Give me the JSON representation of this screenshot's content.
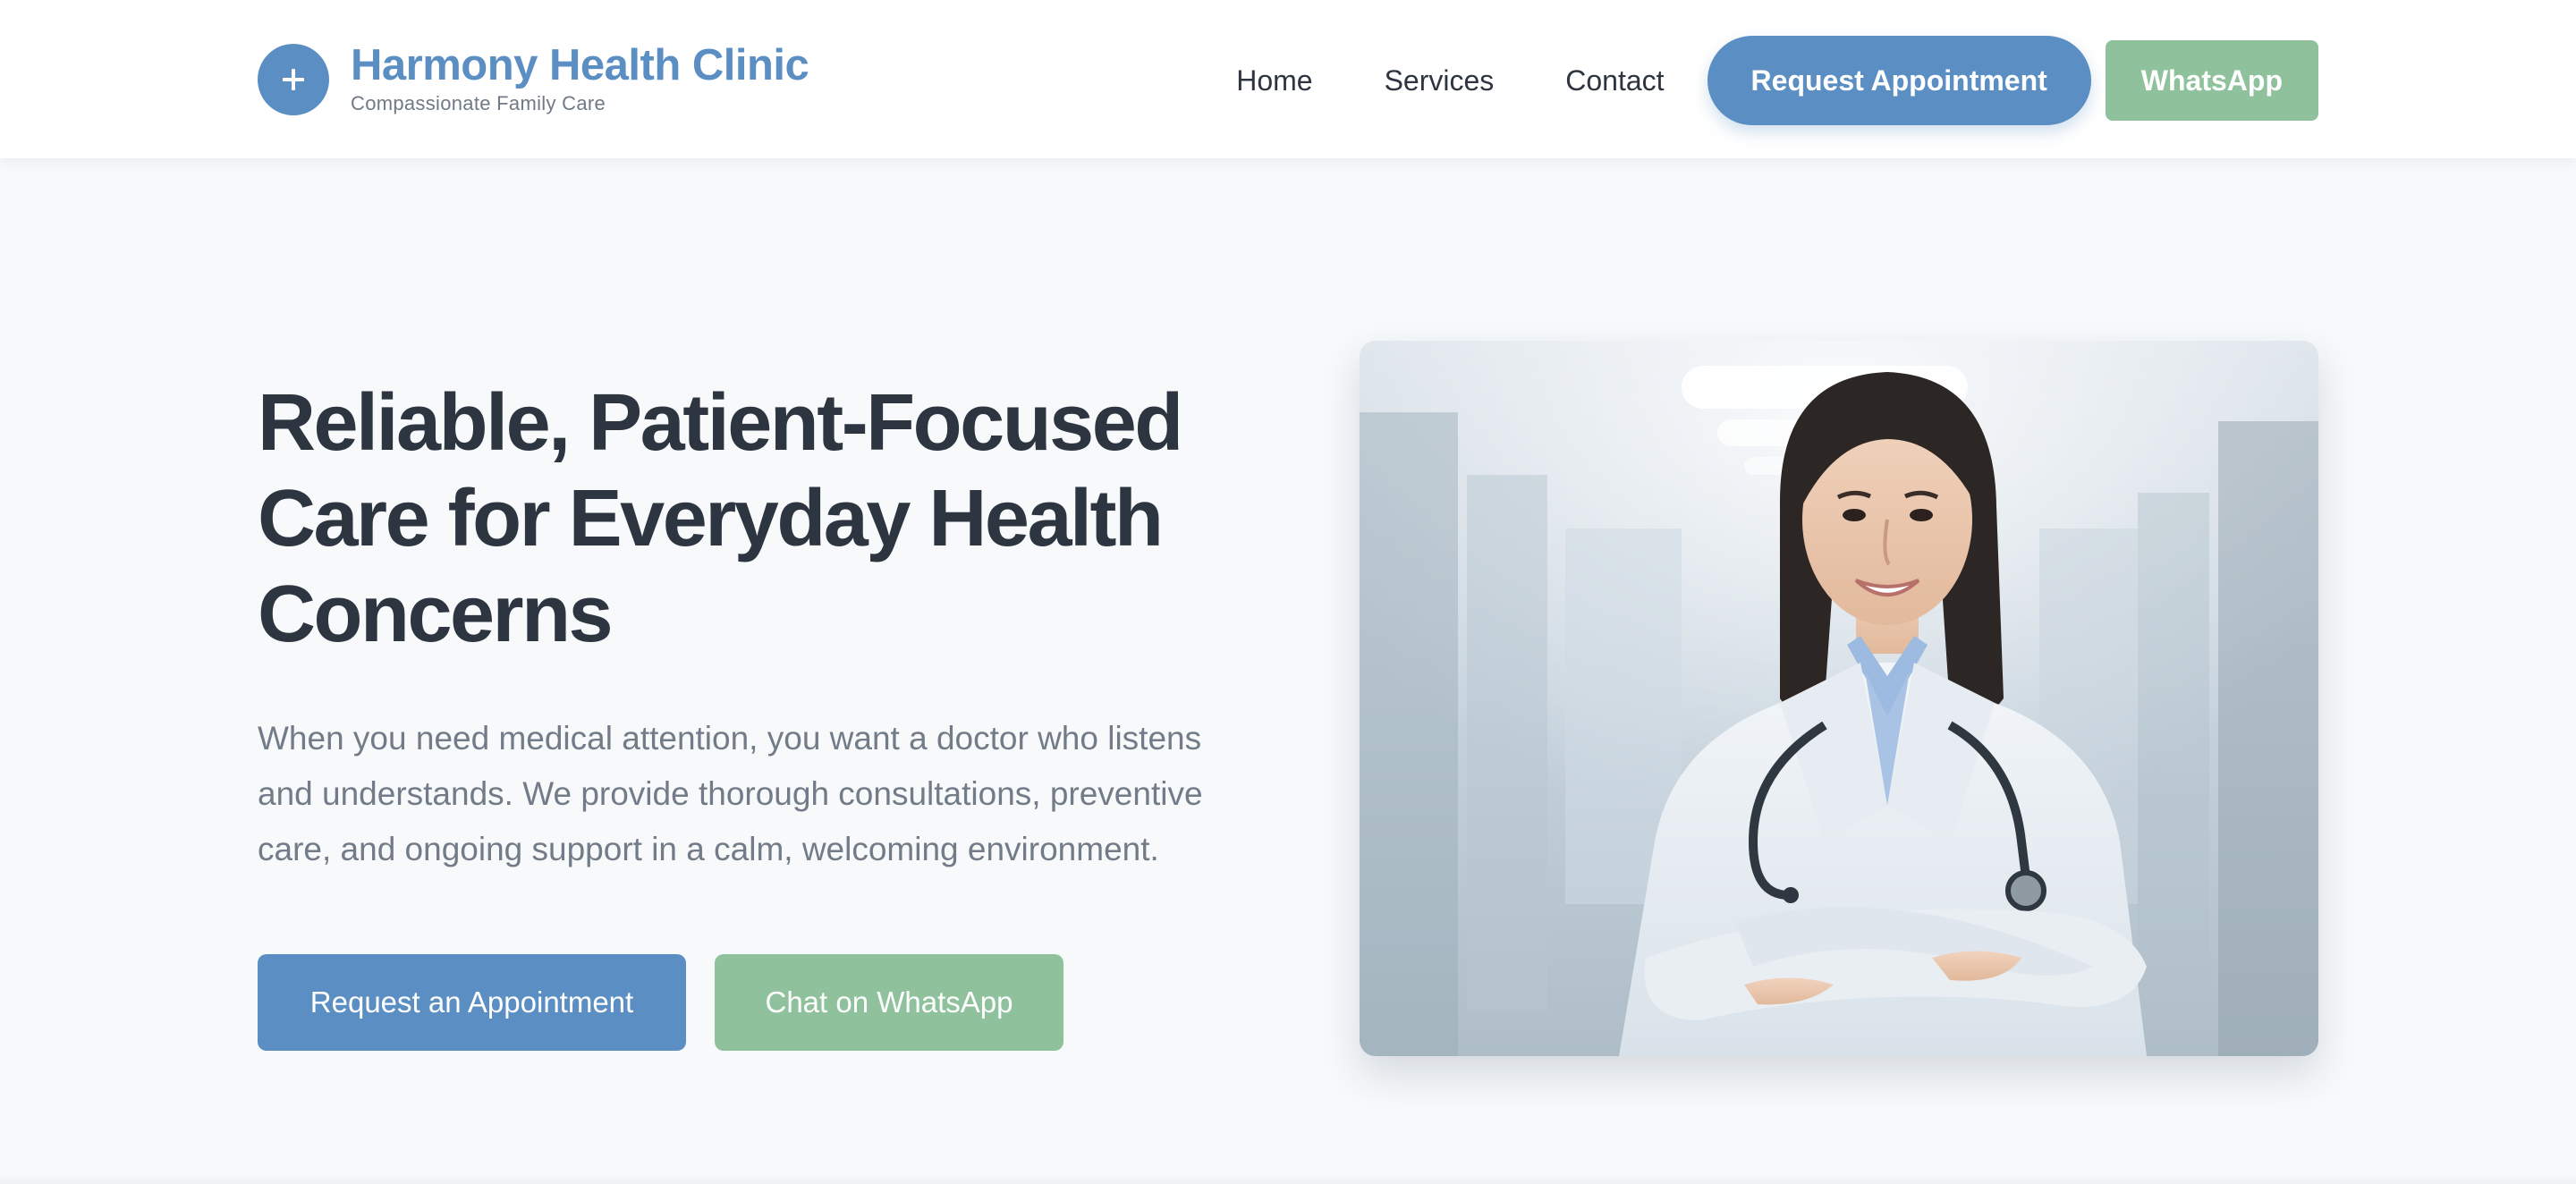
{
  "brand": {
    "name": "Harmony Health Clinic",
    "tagline": "Compassionate Family Care",
    "logo_icon": "plus-icon"
  },
  "nav": {
    "links": [
      "Home",
      "Services",
      "Contact"
    ],
    "request_appointment": "Request Appointment",
    "whatsapp": "WhatsApp"
  },
  "hero": {
    "title": "Reliable, Patient-Focused Care for Everyday Health Concerns",
    "description": "When you need medical attention, you want a doctor who listens and understands. We provide thorough consultations, preventive care, and ongoing support in a calm, welcoming environment.",
    "primary_cta": "Request an Appointment",
    "secondary_cta": "Chat on WhatsApp",
    "image_alt": "Smiling doctor in a white coat with a stethoscope standing in a hospital corridor"
  },
  "colors": {
    "accent_blue": "#5b8fc3",
    "accent_green": "#8fc29c",
    "heading": "#2d3540",
    "body_text": "#727c88",
    "page_bg": "#f7f9fb"
  }
}
